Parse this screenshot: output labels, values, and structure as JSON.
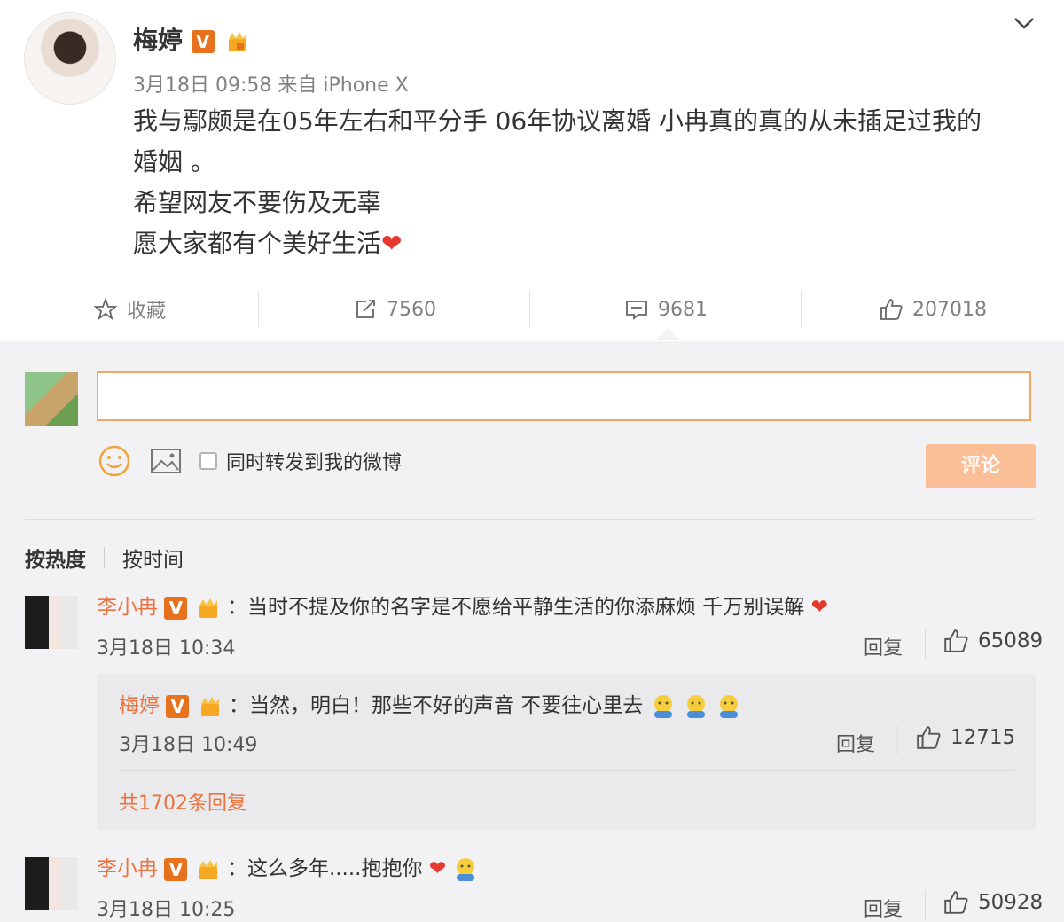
{
  "post": {
    "author": "梅婷",
    "meta": "3月18日 09:58 来自 iPhone X",
    "lines": [
      "我与鄢颇是在05年左右和平分手  06年协议离婚 小冉真的真的从未插足过我的",
      "婚姻 。",
      "希望网友不要伤及无辜",
      "愿大家都有个美好生活"
    ],
    "heart": "❤"
  },
  "actions": {
    "favorite_label": "收藏",
    "repost_count": "7560",
    "comment_count": "9681",
    "like_count": "207018"
  },
  "composer": {
    "input_value": "",
    "repost_label": "同时转发到我的微博",
    "submit_label": "评论"
  },
  "sort": {
    "hot": "按热度",
    "time": "按时间"
  },
  "comments": [
    {
      "author": "李小冉",
      "text": "：当时不提及你的名字是不愿给平静生活的你添麻烦 千万别误解",
      "time": "3月18日 10:34",
      "reply_label": "回复",
      "likes": "65089",
      "sub": {
        "author": "梅婷",
        "text": "：当然，明白！那些不好的声音 不要往心里去",
        "time": "3月18日 10:49",
        "reply_label": "回复",
        "likes": "12715",
        "more": "共1702条回复"
      }
    },
    {
      "author": "李小冉",
      "text": "：这么多年.....抱抱你",
      "time": "3月18日 10:25",
      "reply_label": "回复",
      "likes": "50928"
    }
  ],
  "icons": {
    "verified": "V",
    "colors": {
      "accent": "#eb7340",
      "verified": "#e8711e",
      "heart": "#e5382e",
      "submit": "#fbbf98"
    }
  }
}
